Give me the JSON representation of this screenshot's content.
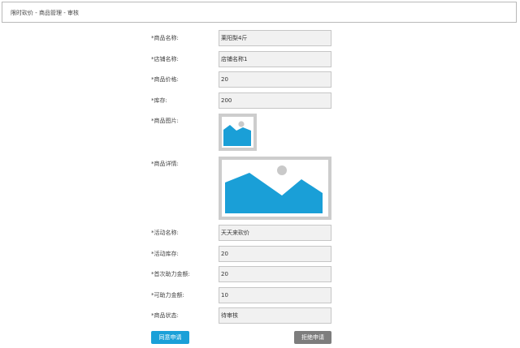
{
  "breadcrumb": "限时砍价 - 商品管理 - 审核",
  "form": {
    "product_name": {
      "label": "*商品名称:",
      "value": "莱阳梨4斤"
    },
    "shop_name": {
      "label": "*店铺名称:",
      "value": "店铺名称1"
    },
    "product_price": {
      "label": "*商品价格:",
      "value": "20"
    },
    "stock": {
      "label": "*库存:",
      "value": "200"
    },
    "product_image": {
      "label": "*商品图片:"
    },
    "product_detail": {
      "label": "*商品详情:"
    },
    "activity_name": {
      "label": "*活动名称:",
      "value": "天天来砍价"
    },
    "activity_stock": {
      "label": "*活动库存:",
      "value": "20"
    },
    "first_help_amount": {
      "label": "*首次助力金额:",
      "value": "20"
    },
    "available_help_amount": {
      "label": "*可助力金额:",
      "value": "10"
    },
    "product_status": {
      "label": "*商品状态:",
      "value": "待审核"
    }
  },
  "actions": {
    "approve_label": "同意申请",
    "reject_label": "拒绝申请"
  },
  "colors": {
    "accent": "#1aa0d8",
    "reject": "#7d7d7d",
    "field_bg": "#f1f1f1",
    "placeholder_frame": "#cdcdcd"
  },
  "icons": {
    "image_placeholder": "image-placeholder-icon"
  }
}
